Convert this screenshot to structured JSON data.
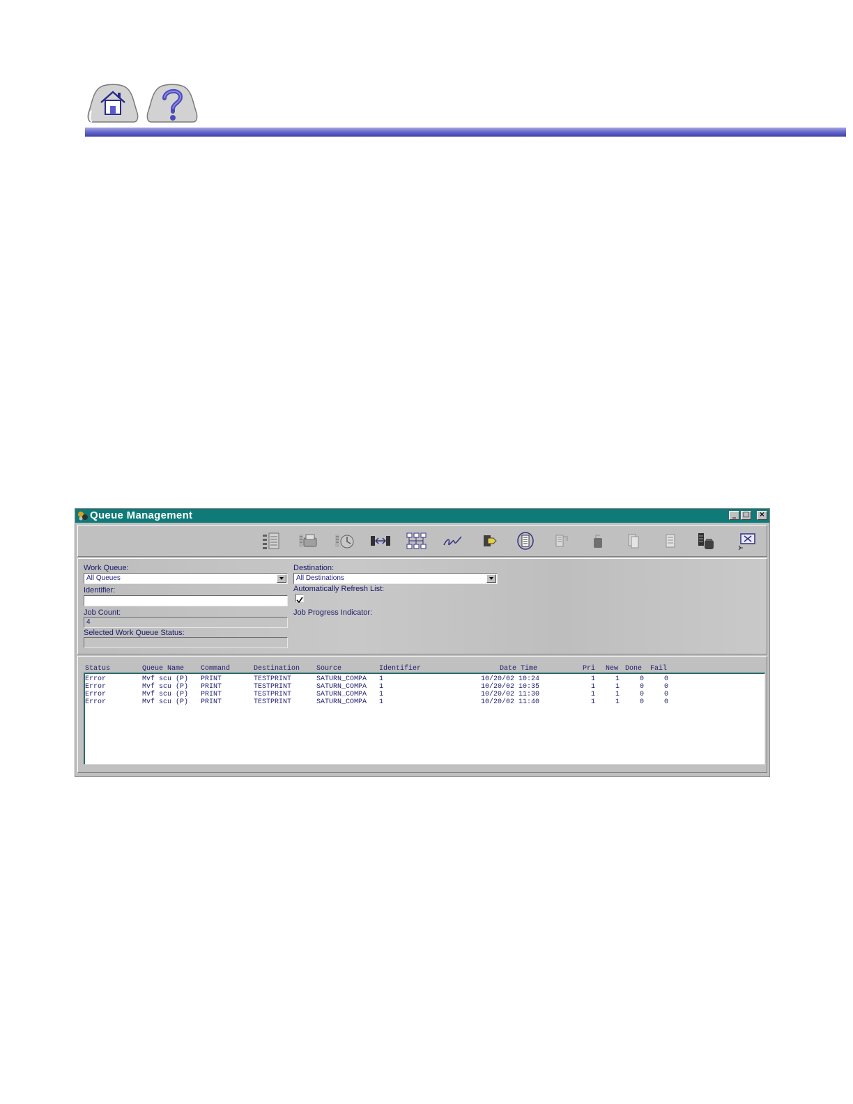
{
  "window": {
    "title": "Queue Management"
  },
  "nav": {
    "home_icon": "home-icon",
    "help_icon": "question-mark-icon"
  },
  "toolbar": {
    "icons": [
      "queue-list-icon",
      "print-job-icon",
      "job-status-icon",
      "transfer-icon",
      "network-nodes-icon",
      "signature-icon",
      "tag-icon",
      "refresh-list-icon",
      "document-icon",
      "disabled-icon",
      "pages-icon",
      "doc-stack-icon",
      "delete-job-icon",
      "exit-icon"
    ]
  },
  "form": {
    "work_queue_label": "Work Queue:",
    "work_queue_value": "All Queues",
    "destination_label": "Destination:",
    "destination_value": "All Destinations",
    "identifier_label": "Identifier:",
    "identifier_value": "",
    "auto_refresh_label": "Automatically Refresh List:",
    "auto_refresh_checked": true,
    "job_count_label": "Job Count:",
    "job_count_value": "4",
    "job_progress_label": "Job Progress Indicator:",
    "selected_status_label": "Selected Work Queue Status:",
    "selected_status_value": ""
  },
  "table": {
    "headers": {
      "status": "Status",
      "queue_name": "Queue Name",
      "command": "Command",
      "destination": "Destination",
      "source": "Source",
      "identifier": "Identifier",
      "date_time": "Date Time",
      "pri": "Pri",
      "new": "New",
      "done": "Done",
      "fail": "Fail"
    },
    "rows": [
      {
        "status": "Error",
        "queue_name": "Mvf scu (P)",
        "command": "PRINT",
        "destination": "TESTPRINT",
        "source": "SATURN_COMPA",
        "identifier": "1",
        "date_time": "10/20/02 10:24",
        "pri": "1",
        "new": "1",
        "done": "0",
        "fail": "0"
      },
      {
        "status": "Error",
        "queue_name": "Mvf scu (P)",
        "command": "PRINT",
        "destination": "TESTPRINT",
        "source": "SATURN_COMPA",
        "identifier": "1",
        "date_time": "10/20/02 10:35",
        "pri": "1",
        "new": "1",
        "done": "0",
        "fail": "0"
      },
      {
        "status": "Error",
        "queue_name": "Mvf scu (P)",
        "command": "PRINT",
        "destination": "TESTPRINT",
        "source": "SATURN_COMPA",
        "identifier": "1",
        "date_time": "10/20/02 11:30",
        "pri": "1",
        "new": "1",
        "done": "0",
        "fail": "0"
      },
      {
        "status": "Error",
        "queue_name": "Mvf scu (P)",
        "command": "PRINT",
        "destination": "TESTPRINT",
        "source": "SATURN_COMPA",
        "identifier": "1",
        "date_time": "10/20/02 11:40",
        "pri": "1",
        "new": "1",
        "done": "0",
        "fail": "0"
      }
    ]
  }
}
